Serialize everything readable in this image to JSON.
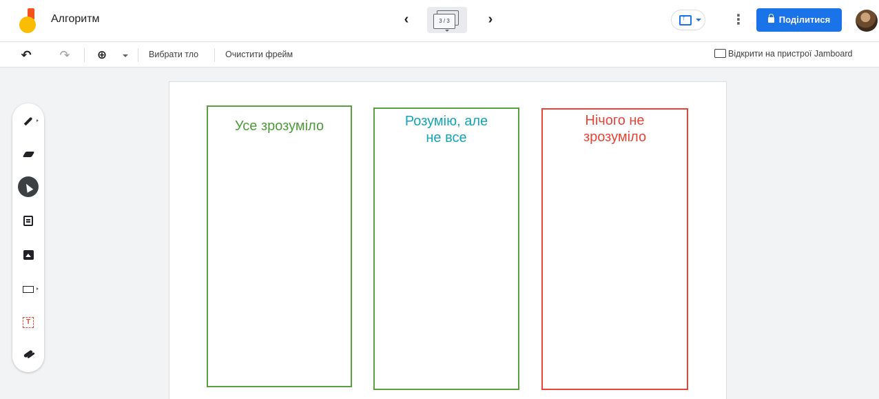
{
  "app": {
    "doc_title": "Алгоритм",
    "frame_indicator": "3 / 3",
    "share_label": "Поділитися"
  },
  "toolbar": {
    "background_label": "Вибрати тло",
    "clear_label": "Очистити фрейм",
    "open_device_label": "Відкрити на пристрої Jamboard"
  },
  "palette": {
    "tools": [
      "pen-icon",
      "eraser-icon",
      "select-icon",
      "sticky-note-icon",
      "image-icon",
      "shape-icon",
      "text-box-icon",
      "laser-icon"
    ],
    "active_tool": "select"
  },
  "board": {
    "columns": [
      {
        "label": "Усе зрозуміло",
        "color": "#4e9a3c"
      },
      {
        "label": "Розумію, але\nне все",
        "color": "#12a6b8"
      },
      {
        "label": "Нічого не\nзрозуміло",
        "color": "#ea4335"
      }
    ]
  },
  "colors": {
    "accent": "#1a73e8",
    "green_border": "#5b9e3f",
    "red_border": "#ea4335"
  }
}
